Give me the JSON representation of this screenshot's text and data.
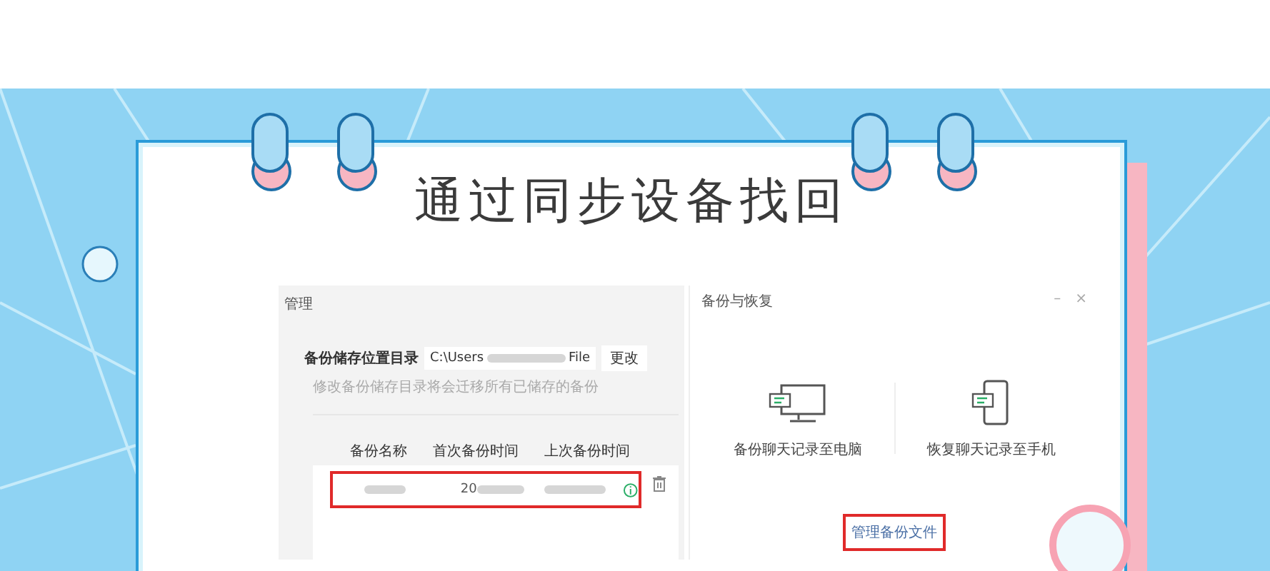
{
  "title": "通过同步设备找回",
  "manage_panel": {
    "title": "管理",
    "storage_label": "备份储存位置目录",
    "path_start": "C:\\Users",
    "path_end": "File",
    "change_button": "更改",
    "hint": "修改备份储存目录将会迁移所有已储存的备份",
    "columns": [
      "备份名称",
      "首次备份时间",
      "上次备份时间"
    ],
    "rows": [
      {
        "first_time": "20",
        "highlighted": true
      }
    ]
  },
  "backup_panel": {
    "title": "备份与恢复",
    "window_controls": [
      "–",
      "×"
    ],
    "options": [
      {
        "label": "备份聊天记录至电脑",
        "kind": "computer"
      },
      {
        "label": "恢复聊天记录至手机",
        "kind": "phone"
      }
    ],
    "manage_link": "管理备份文件",
    "link_highlighted": true
  }
}
